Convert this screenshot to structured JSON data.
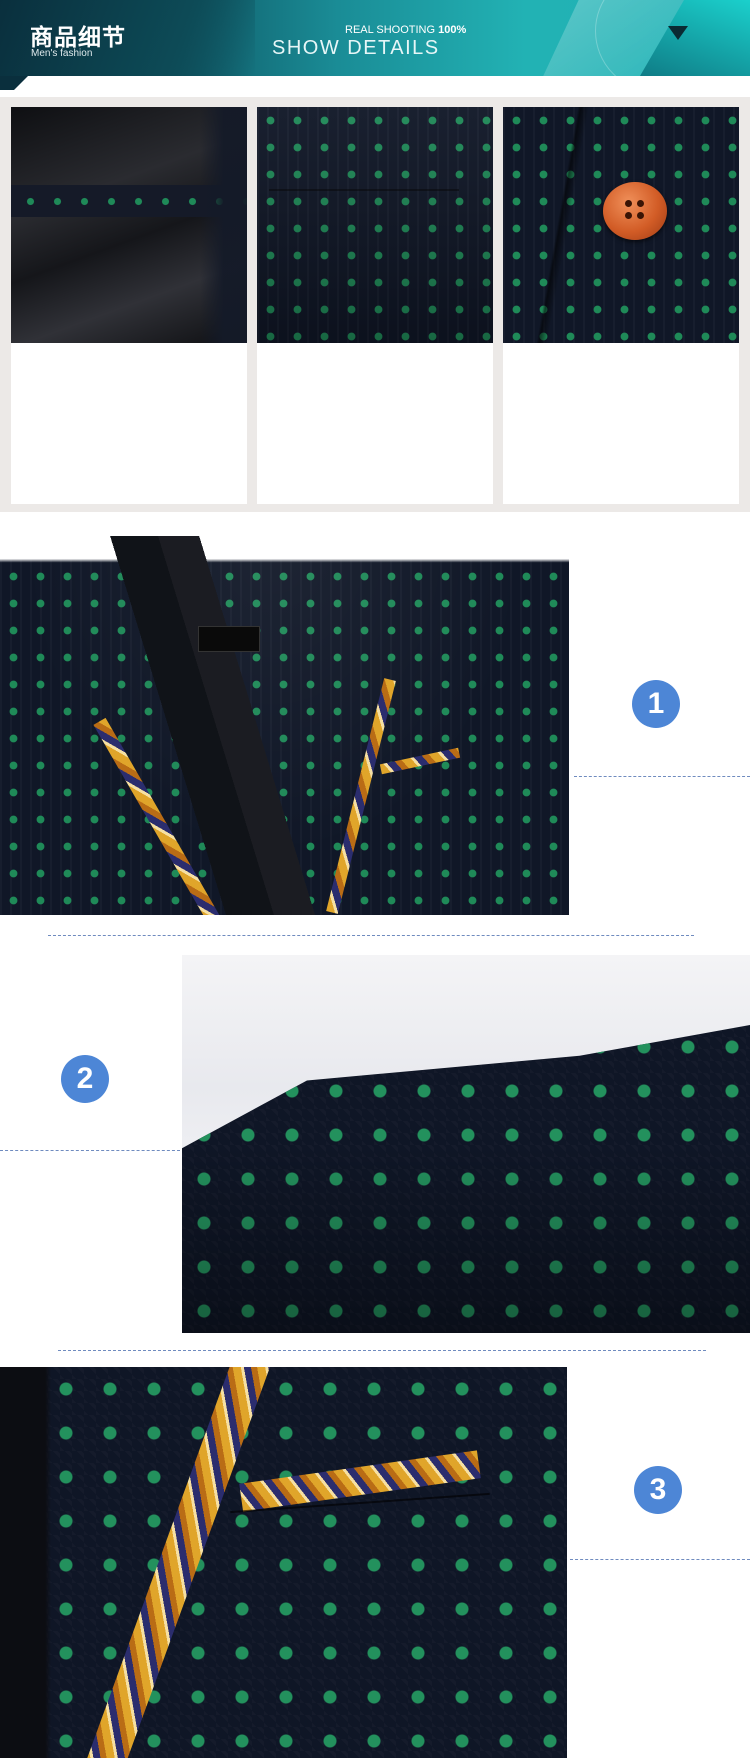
{
  "banner": {
    "title_cn": "商品细节",
    "subtitle": "Men's fashion",
    "real_shooting": "REAL SHOOTING",
    "real_shooting_pct": "100%",
    "show_details": "SHOW DETAILS"
  },
  "thumbnails": [
    {
      "name": "lining-pocket"
    },
    {
      "name": "chest-pocket"
    },
    {
      "name": "wooden-button"
    }
  ],
  "details": [
    {
      "number": "1",
      "name": "collar-detail"
    },
    {
      "number": "2",
      "name": "shoulder-detail"
    },
    {
      "number": "3",
      "name": "pocket-detail"
    }
  ],
  "colors": {
    "fabric": "#101727",
    "dot": "#1f8a58",
    "badge": "#4d86d6",
    "banner_accent": "#1fb3b7"
  }
}
